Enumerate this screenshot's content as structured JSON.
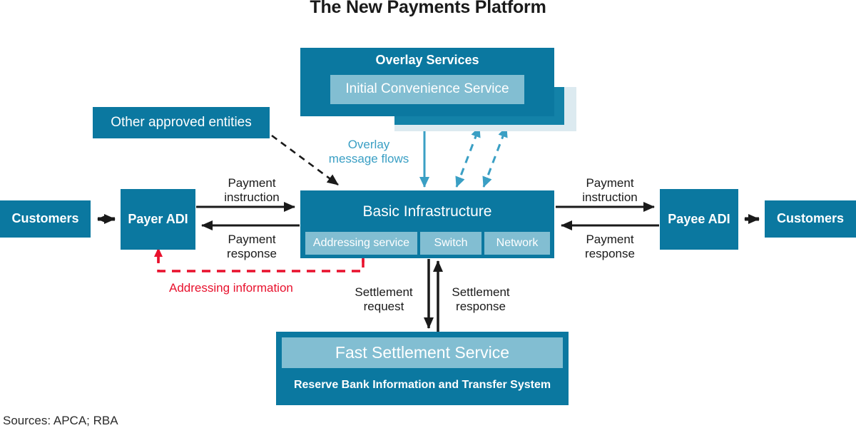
{
  "title": "The New Payments Platform",
  "sources": "Sources: APCA; RBA",
  "colors": {
    "teal": "#0b78a0",
    "light_blue": "#82bed2",
    "pale_blue": "#dceaf0",
    "mid_teal": "#1382a8",
    "arrow_black": "#1a1a1a",
    "arrow_blue": "#3a9fc4",
    "arrow_red": "#e8112d",
    "title_text": "#1a1a1a"
  },
  "boxes": {
    "overlay_services": {
      "title": "Overlay Services",
      "inner": "Initial Convenience Service"
    },
    "other_approved_entities": "Other approved entities",
    "basic_infrastructure": {
      "title": "Basic Infrastructure",
      "components": [
        "Addressing service",
        "Switch",
        "Network"
      ]
    },
    "payer_adi": "Payer\nADI",
    "payee_adi": "Payee\nADI",
    "customers_left": "Customers",
    "customers_right": "Customers",
    "fast_settlement_service": {
      "title": "Fast Settlement Service",
      "subtitle": "Reserve Bank Information and Transfer System"
    }
  },
  "flow_labels": {
    "payment_instruction_left": "Payment\ninstruction",
    "payment_response_left": "Payment\nresponse",
    "payment_instruction_right": "Payment\ninstruction",
    "payment_response_right": "Payment\nresponse",
    "overlay_message_flows": "Overlay\nmessage flows",
    "addressing_information": "Addressing information",
    "settlement_request": "Settlement\nrequest",
    "settlement_response": "Settlement\nresponse"
  },
  "chart_data": {
    "type": "diagram",
    "title": "The New Payments Platform",
    "nodes": [
      {
        "id": "customers_left",
        "label": "Customers",
        "style": "teal"
      },
      {
        "id": "payer_adi",
        "label": "Payer ADI",
        "style": "teal"
      },
      {
        "id": "other_approved_entities",
        "label": "Other approved entities",
        "style": "teal"
      },
      {
        "id": "overlay_services",
        "label": "Overlay Services",
        "style": "teal",
        "children": [
          "Initial Convenience Service"
        ]
      },
      {
        "id": "basic_infrastructure",
        "label": "Basic Infrastructure",
        "style": "teal",
        "children": [
          "Addressing service",
          "Switch",
          "Network"
        ]
      },
      {
        "id": "payee_adi",
        "label": "Payee ADI",
        "style": "teal"
      },
      {
        "id": "customers_right",
        "label": "Customers",
        "style": "teal"
      },
      {
        "id": "fast_settlement_service",
        "label": "Fast Settlement Service",
        "style": "light-blue",
        "children": [
          "Reserve Bank Information and Transfer System"
        ]
      }
    ],
    "edges": [
      {
        "from": "customers_left",
        "to": "payer_adi",
        "label": "",
        "style": "solid-black",
        "direction": "both"
      },
      {
        "from": "payer_adi",
        "to": "basic_infrastructure",
        "label": "Payment instruction",
        "style": "solid-black",
        "direction": "forward"
      },
      {
        "from": "basic_infrastructure",
        "to": "payer_adi",
        "label": "Payment response",
        "style": "solid-black",
        "direction": "forward"
      },
      {
        "from": "basic_infrastructure",
        "to": "payee_adi",
        "label": "Payment instruction",
        "style": "solid-black",
        "direction": "forward"
      },
      {
        "from": "payee_adi",
        "to": "basic_infrastructure",
        "label": "Payment response",
        "style": "solid-black",
        "direction": "forward"
      },
      {
        "from": "payee_adi",
        "to": "customers_right",
        "label": "",
        "style": "solid-black",
        "direction": "both"
      },
      {
        "from": "other_approved_entities",
        "to": "basic_infrastructure",
        "label": "",
        "style": "dashed-black",
        "direction": "forward"
      },
      {
        "from": "basic_infrastructure",
        "to": "overlay_services",
        "label": "Overlay message flows",
        "style": "solid-blue",
        "direction": "both"
      },
      {
        "from": "basic_infrastructure",
        "to": "overlay_services",
        "label": "",
        "style": "dashed-blue",
        "direction": "both"
      },
      {
        "from": "basic_infrastructure",
        "to": "overlay_services",
        "label": "",
        "style": "dashed-blue",
        "direction": "both"
      },
      {
        "from": "basic_infrastructure",
        "to": "fast_settlement_service",
        "label": "Settlement request",
        "style": "solid-black",
        "direction": "forward"
      },
      {
        "from": "fast_settlement_service",
        "to": "basic_infrastructure",
        "label": "Settlement response",
        "style": "solid-black",
        "direction": "forward"
      },
      {
        "from": "basic_infrastructure",
        "to": "payer_adi",
        "label": "Addressing information",
        "style": "dashed-red",
        "direction": "both"
      }
    ]
  }
}
